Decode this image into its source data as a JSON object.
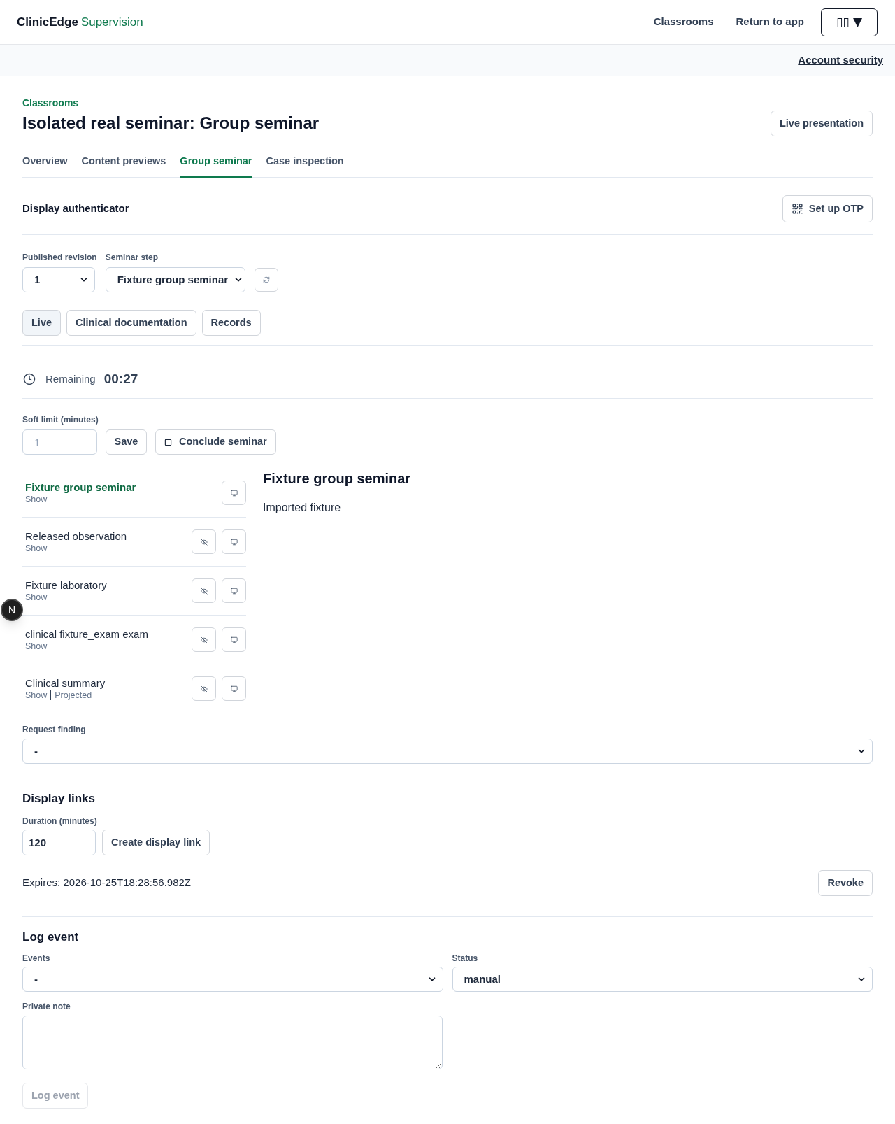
{
  "header": {
    "brand": "ClinicEdge",
    "product": "Supervision",
    "nav": [
      {
        "label": "Classrooms"
      },
      {
        "label": "Return to app"
      }
    ],
    "menu_button": {
      "label": "▯▯",
      "caret": "▼"
    }
  },
  "subbar": {
    "link": "Account security"
  },
  "page": {
    "breadcrumb": "Classrooms",
    "title": "Isolated real seminar: Group seminar",
    "action": "Live presentation"
  },
  "tabs": [
    {
      "label": "Overview",
      "selected": false
    },
    {
      "label": "Content previews",
      "selected": false
    },
    {
      "label": "Group seminar",
      "selected": true
    },
    {
      "label": "Case inspection",
      "selected": false
    }
  ],
  "authenticator": {
    "title": "Display authenticator",
    "button": "Set up OTP"
  },
  "selectors": {
    "revision": {
      "label": "Published revision",
      "value": "1"
    },
    "step": {
      "label": "Seminar step",
      "value": "Fixture group seminar"
    }
  },
  "modes": [
    {
      "label": "Live",
      "selected": true
    },
    {
      "label": "Clinical documentation",
      "selected": false
    },
    {
      "label": "Records",
      "selected": false
    }
  ],
  "timer": {
    "label": "Remaining",
    "value": "00:27"
  },
  "soft_limit": {
    "label": "Soft limit (minutes)",
    "placeholder": "1",
    "save": "Save",
    "conclude": "Conclude seminar"
  },
  "steps": [
    {
      "title": "Fixture group seminar",
      "status": [
        "Show"
      ],
      "selected": true,
      "can_hide": false
    },
    {
      "title": "Released observation",
      "status": [
        "Show"
      ],
      "selected": false,
      "can_hide": true
    },
    {
      "title": "Fixture laboratory",
      "status": [
        "Show"
      ],
      "selected": false,
      "can_hide": true
    },
    {
      "title": "clinical fixture_exam exam",
      "status": [
        "Show"
      ],
      "selected": false,
      "can_hide": true
    },
    {
      "title": "Clinical summary",
      "status": [
        "Show",
        "Projected"
      ],
      "selected": false,
      "can_hide": true
    }
  ],
  "preview": {
    "title": "Fixture group seminar",
    "body": "Imported fixture"
  },
  "request_finding": {
    "label": "Request finding",
    "value": "-"
  },
  "display_links": {
    "title": "Display links",
    "duration_label": "Duration (minutes)",
    "duration": "120",
    "create": "Create display link",
    "expires": "Expires: 2026-10-25T18:28:56.982Z",
    "revoke": "Revoke"
  },
  "log_event": {
    "title": "Log event",
    "events": {
      "label": "Events",
      "value": "-"
    },
    "status": {
      "label": "Status",
      "value": "manual"
    },
    "note": {
      "label": "Private note"
    },
    "submit": {
      "label": "Log event",
      "disabled": true
    }
  },
  "dev_badge": {
    "label": "N"
  }
}
